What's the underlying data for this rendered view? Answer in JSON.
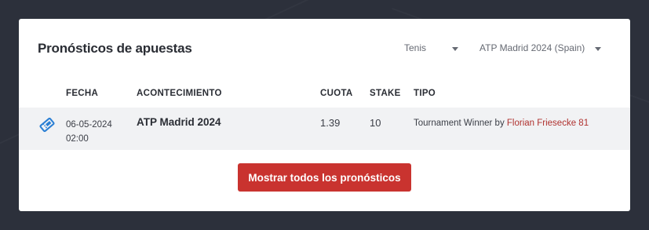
{
  "card": {
    "title": "Pronósticos de apuestas"
  },
  "filters": {
    "sport": {
      "selected": "Tenis",
      "icon": "chevron-down-icon"
    },
    "event": {
      "selected": "ATP Madrid 2024 (Spain)",
      "icon": "chevron-down-icon"
    }
  },
  "table": {
    "columns": [
      "FECHA",
      "ACONTECIMIENTO",
      "CUOTA",
      "STAKE",
      "TIPO"
    ],
    "rows": [
      {
        "icon": "ticket-icon",
        "date": "06-05-2024",
        "time": "02:00",
        "event": "ATP Madrid 2024",
        "odds": "1.39",
        "stake": "10",
        "type_prefix": "Tournament Winner by",
        "tipster": "Florian Friesecke 81"
      }
    ]
  },
  "actions": {
    "show_all_label": "Mostrar todos los pronósticos"
  },
  "colors": {
    "background": "#2c303b",
    "accent": "#c9332f",
    "link": "#b0322f",
    "icon": "#2a7fd4"
  }
}
